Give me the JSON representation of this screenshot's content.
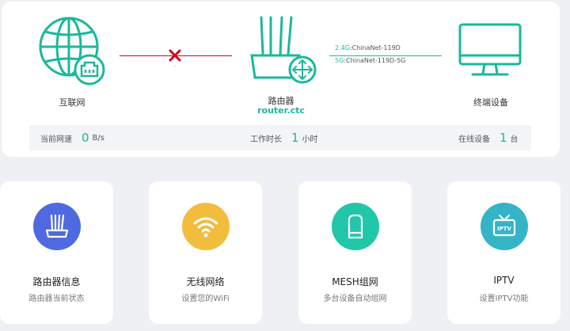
{
  "topology": {
    "internet_label": "互联网",
    "router_label": "路由器",
    "router_host": "router.ctc",
    "devices_label": "终端设备",
    "wan_status_mark": "-",
    "wifi_24_band": "2.4G",
    "wifi_24_ssid": ":ChinaNet-119D",
    "wifi_5_band": "5G",
    "wifi_5_ssid": ":ChinaNet-119D-5G"
  },
  "stats": {
    "speed_label": "当前网速",
    "speed_value": "0",
    "speed_unit": "B/s",
    "uptime_label": "工作时长",
    "uptime_value": "1",
    "uptime_unit": "小时",
    "online_label": "在线设备",
    "online_value": "1",
    "online_unit": "台"
  },
  "cards": [
    {
      "title": "路由器信息",
      "subtitle": "路由器当前状态",
      "icon": "router-icon",
      "color": "#4f6ae0"
    },
    {
      "title": "无线网络",
      "subtitle": "设置您的WiFi",
      "icon": "wifi-icon",
      "color": "#f2bd3c"
    },
    {
      "title": "MESH组网",
      "subtitle": "多台设备自动组网",
      "icon": "mesh-icon",
      "color": "#22c6a8"
    },
    {
      "title": "IPTV",
      "subtitle": "设置IPTV功能",
      "icon": "tv-icon",
      "color": "#35b4c8",
      "badge": "IPTV"
    }
  ],
  "colors": {
    "accent": "#1ab89b",
    "disconnected": "#d0021b"
  }
}
